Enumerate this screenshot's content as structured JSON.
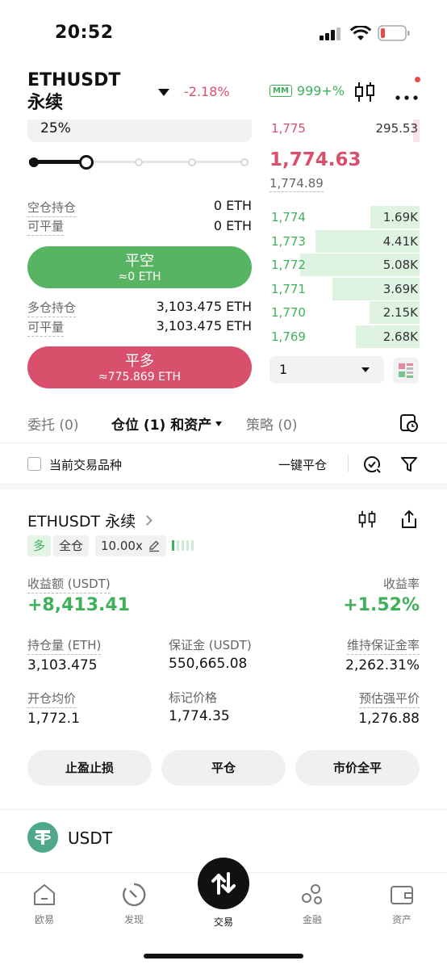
{
  "status_bar": {
    "time": "20:52"
  },
  "header": {
    "pair": "ETHUSDT 永续",
    "change": "-2.18%",
    "mm_badge": "MM",
    "mm_value": "999+%"
  },
  "order_form": {
    "percent_value": "25%",
    "slider_fraction": 0.25,
    "short_position_label": "空仓持仓",
    "short_position_value": "0 ETH",
    "short_closable_label": "可平量",
    "short_closable_value": "0 ETH",
    "close_short_button": "平空",
    "close_short_sub": "≈0 ETH",
    "long_position_label": "多仓持仓",
    "long_position_value": "3,103.475 ETH",
    "long_closable_label": "可平量",
    "long_closable_value": "3,103.475 ETH",
    "close_long_button": "平多",
    "close_long_sub": "≈775.869 ETH"
  },
  "orderbook": {
    "top_ask_price": "1,775",
    "top_ask_qty": "295.53",
    "last_price": "1,774.63",
    "mark_price": "1,774.89",
    "bids": [
      {
        "price": "1,774",
        "qty": "1.69K",
        "depth": 0.41
      },
      {
        "price": "1,773",
        "qty": "4.41K",
        "depth": 0.87
      },
      {
        "price": "1,772",
        "qty": "5.08K",
        "depth": 1.0
      },
      {
        "price": "1,771",
        "qty": "3.69K",
        "depth": 0.73
      },
      {
        "price": "1,770",
        "qty": "2.15K",
        "depth": 0.42
      },
      {
        "price": "1,769",
        "qty": "2.68K",
        "depth": 0.53
      }
    ],
    "precision_value": "1"
  },
  "tabs": {
    "orders": "委托 (0)",
    "positions": "仓位 (1) 和资产",
    "strategies": "策略 (0)"
  },
  "filter_bar": {
    "current_symbol_label": "当前交易品种",
    "close_all_label": "一键平仓"
  },
  "position": {
    "symbol": "ETHUSDT 永续",
    "side_tag": "多",
    "margin_mode_tag": "全仓",
    "leverage_tag": "10.00x",
    "pnl_label": "收益额 (USDT)",
    "pnl_value": "+8,413.41",
    "roi_label": "收益率",
    "roi_value": "+1.52%",
    "size_label": "持仓量 (ETH)",
    "size_value": "3,103.475",
    "margin_label": "保证金 (USDT)",
    "margin_value": "550,665.08",
    "mmr_label": "维持保证金率",
    "mmr_value": "2,262.31%",
    "entry_label": "开仓均价",
    "entry_value": "1,772.1",
    "mark_label": "标记价格",
    "mark_value": "1,774.35",
    "liq_label": "预估强平价",
    "liq_value": "1,276.88",
    "tpsl_button": "止盈止损",
    "close_button": "平仓",
    "market_close_button": "市价全平"
  },
  "asset": {
    "name": "USDT"
  },
  "bottom_nav": [
    {
      "label": "欧易"
    },
    {
      "label": "发现"
    },
    {
      "label": "交易"
    },
    {
      "label": "金融"
    },
    {
      "label": "资产"
    }
  ],
  "colors": {
    "green": "#3fb15a",
    "red": "#d9506d",
    "tether": "#4fa88b"
  }
}
